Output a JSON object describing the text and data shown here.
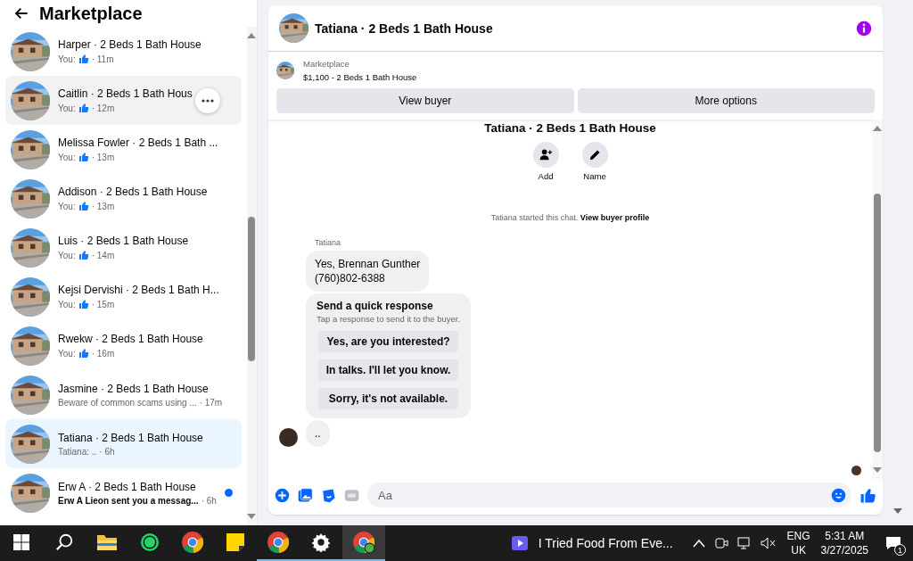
{
  "sidebar": {
    "title": "Marketplace",
    "items": [
      {
        "name": "Harper · 2 Beds 1 Bath House",
        "preview": "You:",
        "like": true,
        "time": "· 11m",
        "selected": false,
        "hovered": false,
        "unread": false
      },
      {
        "name": "Caitlin · 2 Beds 1 Bath Hous",
        "preview": "You:",
        "like": true,
        "time": "· 12m",
        "selected": false,
        "hovered": true,
        "unread": false
      },
      {
        "name": "Melissa Fowler · 2 Beds 1 Bath ...",
        "preview": "You:",
        "like": true,
        "time": "· 13m",
        "selected": false,
        "hovered": false,
        "unread": false
      },
      {
        "name": "Addison · 2 Beds 1 Bath House",
        "preview": "You:",
        "like": true,
        "time": "· 13m",
        "selected": false,
        "hovered": false,
        "unread": false
      },
      {
        "name": "Luis · 2 Beds 1 Bath House",
        "preview": "You:",
        "like": true,
        "time": "· 14m",
        "selected": false,
        "hovered": false,
        "unread": false
      },
      {
        "name": "Kejsi Dervishi · 2 Beds 1 Bath H...",
        "preview": "You:",
        "like": true,
        "time": "· 15m",
        "selected": false,
        "hovered": false,
        "unread": false
      },
      {
        "name": "Rwekw · 2 Beds 1 Bath House",
        "preview": "You:",
        "like": true,
        "time": "· 16m",
        "selected": false,
        "hovered": false,
        "unread": false
      },
      {
        "name": "Jasmine · 2 Beds 1 Bath House",
        "preview": "Beware of common scams using ...",
        "like": false,
        "time": "· 17m",
        "selected": false,
        "hovered": false,
        "unread": false
      },
      {
        "name": "Tatiana · 2 Beds 1 Bath House",
        "preview": "Tatiana: ..",
        "like": false,
        "time": "· 6h",
        "selected": true,
        "hovered": false,
        "unread": false
      },
      {
        "name": "Erw A · 2 Beds 1 Bath House",
        "preview": "Erw A Lieon sent you a messag...",
        "like": false,
        "time": "· 6h",
        "selected": false,
        "hovered": false,
        "unread": true
      }
    ]
  },
  "chat": {
    "title": "Tatiana · 2 Beds 1 Bath House",
    "listing": {
      "label": "Marketplace",
      "detail": "$1,100 - 2 Beds 1 Bath House"
    },
    "buttons": [
      "View buyer",
      "More options"
    ],
    "intro": {
      "title": "Tatiana · 2 Beds 1 Bath House",
      "actions": [
        {
          "kind": "add",
          "label": "Add"
        },
        {
          "kind": "name",
          "label": "Name"
        }
      ],
      "notice": "Tatiana started this chat.",
      "link": "View buyer profile"
    },
    "sender": "Tatiana",
    "messages": [
      {
        "kind": "text",
        "lines": [
          "Yes, Brennan Gunther",
          "(760)802-6388"
        ]
      },
      {
        "kind": "quick",
        "title": "Send a quick response",
        "subtitle": "Tap a response to send it to the buyer.",
        "options": [
          "Yes, are you interested?",
          "In talks. I'll let you know.",
          "Sorry, it's not available."
        ]
      },
      {
        "kind": "text",
        "lines": [
          ".."
        ]
      }
    ],
    "composer": {
      "placeholder": "Aa"
    }
  },
  "taskbar": {
    "apps": [
      {
        "kind": "search",
        "running": false
      },
      {
        "kind": "folder",
        "running": false
      },
      {
        "kind": "whatsapp",
        "running": false
      },
      {
        "kind": "chrome",
        "running": false
      },
      {
        "kind": "notes",
        "running": false
      },
      {
        "kind": "chrome",
        "running": true
      },
      {
        "kind": "settings",
        "running": true
      },
      {
        "kind": "chrome-profile",
        "running": true
      }
    ],
    "media": "I Tried Food From Eve...",
    "language": [
      "ENG",
      "UK"
    ],
    "time": "5:31 AM",
    "date": "3/27/2025",
    "notifications": "1"
  }
}
